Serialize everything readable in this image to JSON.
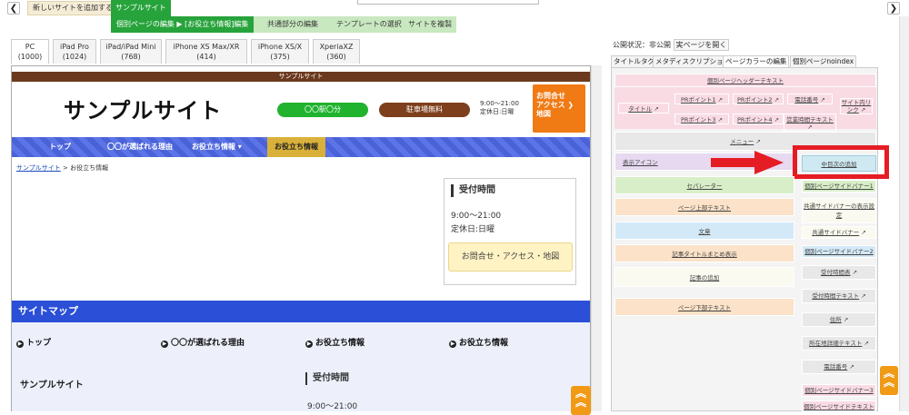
{
  "topbar": {
    "back_icon": "chevron-left-icon",
    "forward_icon": "chevron-right-icon",
    "add_site": "新しいサイトを追加する",
    "site_name": "サンプルサイト"
  },
  "subnav": {
    "active": "個別ページの編集 ▶ [お役立ち情報]編集",
    "items": [
      "共通部分の編集",
      "テンプレートの選択",
      "サイトを複製"
    ]
  },
  "devices": [
    {
      "name": "PC",
      "size": "(1000)"
    },
    {
      "name": "iPad Pro",
      "size": "(1024)"
    },
    {
      "name": "iPad/iPad Mini",
      "size": "(768)"
    },
    {
      "name": "iPhone XS Max/XR",
      "size": "(414)"
    },
    {
      "name": "iPhone XS/X",
      "size": "(375)"
    },
    {
      "name": "XperiaXZ",
      "size": "(360)"
    }
  ],
  "preview": {
    "top_label": "サンプルサイト",
    "logo": "サンプルサイト",
    "station": "〇〇駅〇分",
    "parking": "駐車場無料",
    "hours_line1": "9:00～21:00",
    "hours_line2": "定休日:日曜",
    "contact_btn": [
      "お問合せ",
      "アクセス",
      "地図"
    ],
    "nav": [
      "トップ",
      "〇〇が選ばれる理由",
      "お役立ち情報 ▾",
      "お役立ち情報"
    ],
    "breadcrumb_link": "サンプルサイト",
    "breadcrumb_current": " > お役立ち情報",
    "reception_title": "受付時間",
    "reception_hours": "9:00～21:00",
    "reception_closed": "定休日:日曜",
    "reception_btn": "お問合せ・アクセス・地図",
    "sitemap_title": "サイトマップ",
    "sitemap_items": [
      "トップ",
      "〇〇が選ばれる理由",
      "お役立ち情報",
      "お役立ち情報"
    ],
    "footer_name": "サンプルサイト",
    "footer_title": "受付時間",
    "footer_hours": "9:00～21:00"
  },
  "right": {
    "status": "公開状況：非公開",
    "open_btn": "実ページを開く",
    "tabs": [
      "タイトルタグ",
      "メタディスクリプション",
      "ページカラーの編集",
      "個別ページnoindex"
    ],
    "header_text": "個別ページヘッダーテキスト",
    "title_cell": "タイトル",
    "points": [
      "PRポイント1",
      "PRポイント2",
      "PRポイント3",
      "PRポイント4"
    ],
    "phone": "電話番号",
    "business_hours": "営業時間テキスト",
    "site_map": "サイト内リンク",
    "menu": "メニュー",
    "display_icon": "表示アイコン",
    "add_toc": "中目次の追加",
    "left_items": [
      "セパレーター",
      "ページ上部テキスト",
      "文章",
      "記事タイトルまとめ表示",
      "記事の追加",
      "ページ下部テキスト"
    ],
    "right_items": [
      "個別ページサイドバナー1",
      "共通サイドバナーの表示設定",
      "共通サイドバナー",
      "個別ページサイドバナー2",
      "受付時間表",
      "受付時間テキスト",
      "住所",
      "所在地詳細テキスト",
      "電話番号",
      "個別ページサイドバナー3",
      "個別ページサイドテキスト"
    ],
    "colors": {
      "pink": "#f9dbe4",
      "purple": "#e6d9f0",
      "green": "#d8eec8",
      "orange": "#fbe2c8",
      "blue": "#d3e9f7",
      "red": "#e51c23"
    }
  }
}
